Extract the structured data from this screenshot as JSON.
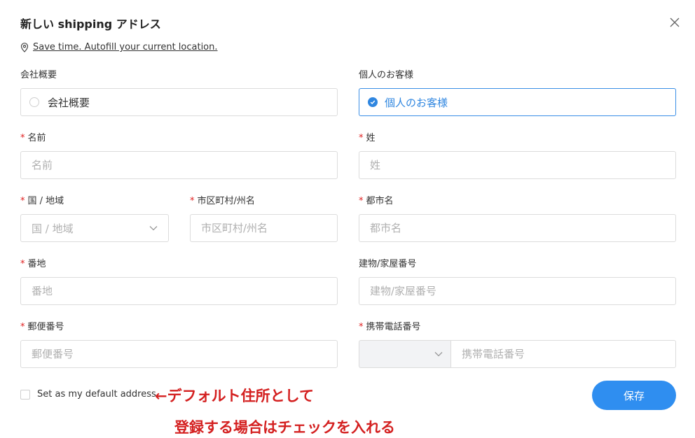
{
  "dialog": {
    "title": "新しい shipping アドレス",
    "icons": {
      "close": "close-icon",
      "location": "location-pin-icon"
    }
  },
  "autofill": {
    "link_text": "Save time. Autofill your current location."
  },
  "customer_type": {
    "company": {
      "label": "会社概要",
      "option_text": "会社概要",
      "selected": false
    },
    "individual": {
      "label": "個人のお客様",
      "option_text": "個人のお客様",
      "selected": true
    }
  },
  "fields": {
    "first_name": {
      "label": "名前",
      "placeholder": "名前",
      "required": true
    },
    "last_name": {
      "label": "姓",
      "placeholder": "姓",
      "required": true
    },
    "country": {
      "label": "国 / 地域",
      "placeholder": "国 / 地域",
      "required": true
    },
    "city_state": {
      "label": "市区町村/州名",
      "placeholder": "市区町村/州名",
      "required": true
    },
    "city": {
      "label": "都市名",
      "placeholder": "都市名",
      "required": true
    },
    "address": {
      "label": "番地",
      "placeholder": "番地",
      "required": true
    },
    "building": {
      "label": "建物/家屋番号",
      "placeholder": "建物/家屋番号",
      "required": false
    },
    "postal_code": {
      "label": "郵便番号",
      "placeholder": "郵便番号",
      "required": true
    },
    "phone": {
      "label": "携帯電話番号",
      "placeholder": "携帯電話番号",
      "required": true,
      "country_code": ""
    }
  },
  "required_mark": "*",
  "default_address": {
    "label": "Set as my default address",
    "checked": false
  },
  "annotation": {
    "line1": "←デフォルト住所として",
    "line2": "登録する場合はチェックを入れる"
  },
  "save_button": {
    "label": "保存"
  },
  "colors": {
    "accent": "#2f8ef0",
    "required": "#e02020",
    "annotation": "#d42020"
  }
}
